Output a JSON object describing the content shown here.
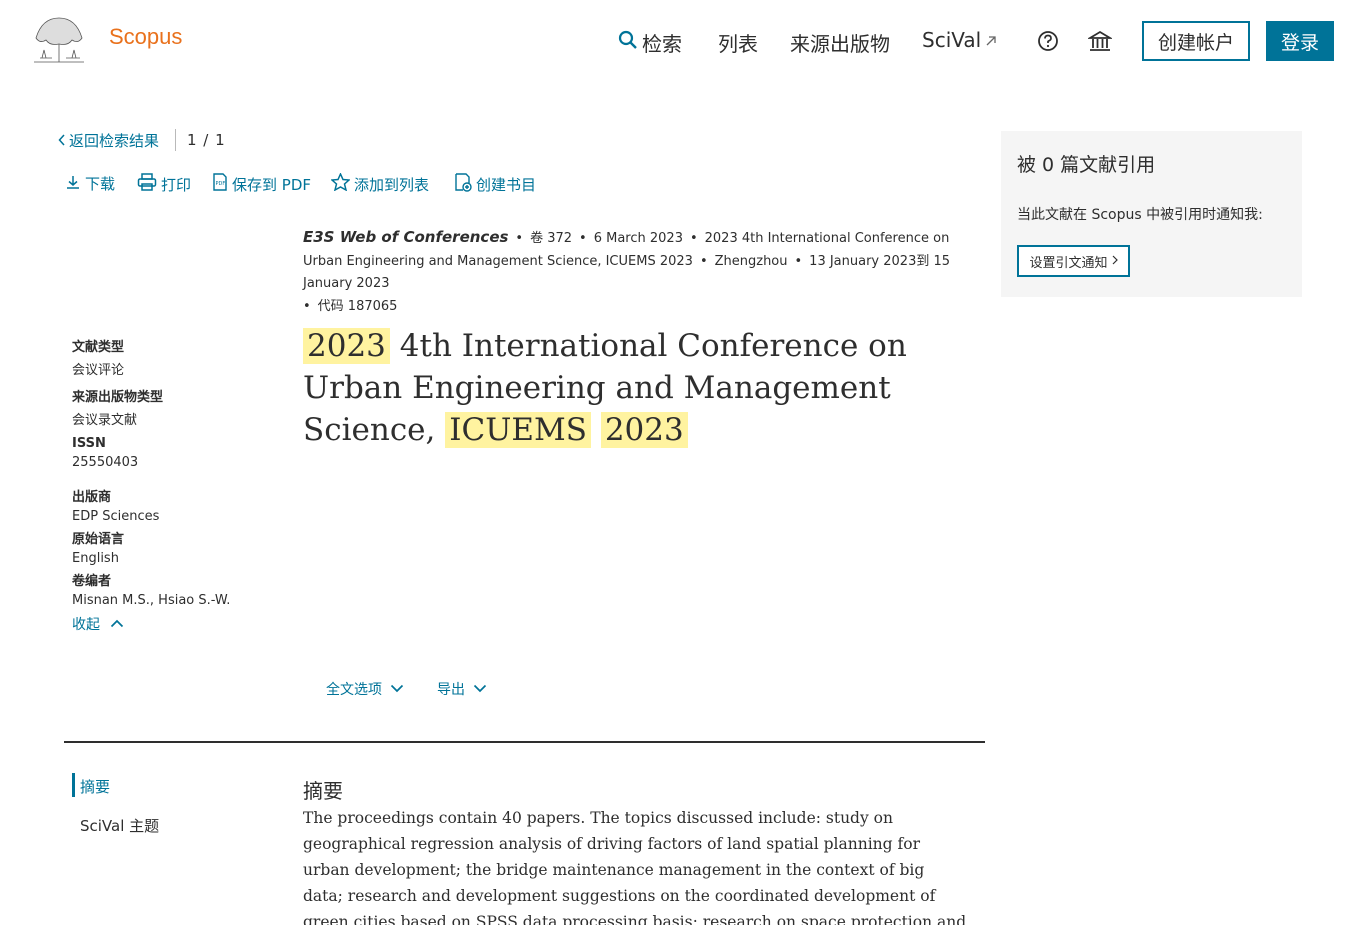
{
  "header": {
    "brand": "Scopus",
    "nav": {
      "search": "检索",
      "lists": "列表",
      "sources": "来源出版物",
      "scival": "SciVal"
    },
    "create_account": "创建帐户",
    "login": "登录"
  },
  "breadcrumb": {
    "back": "返回检索结果",
    "pager": "1 / 1"
  },
  "toolbar": {
    "download": "下载",
    "print": "打印",
    "save_pdf": "保存到 PDF",
    "add_to_list": "添加到列表",
    "create_bib": "创建书目"
  },
  "source": {
    "journal": "E3S Web of Conferences",
    "volume": "卷 372",
    "date": "6 March 2023",
    "conference": "2023 4th International Conference on Urban Engineering and Management Science, ICUEMS 2023",
    "location": "Zhengzhou",
    "conf_dates": "13 January 2023到 15 January 2023",
    "code": "代码 187065"
  },
  "title": {
    "part1": "2023",
    "part2": " 4th International Conference on Urban Engineering and Management Science, ",
    "part3": "ICUEMS",
    "part4": "2023"
  },
  "metadata": {
    "doc_type_label": "文献类型",
    "doc_type": "会议评论",
    "source_type_label": "来源出版物类型",
    "source_type": "会议录文献",
    "issn_label": "ISSN",
    "issn": "25550403",
    "publisher_label": "出版商",
    "publisher": "EDP Sciences",
    "language_label": "原始语言",
    "language": "English",
    "editors_label": "卷编者",
    "editors": "Misnan M.S., Hsiao S.-W.",
    "collapse": "收起"
  },
  "cite_panel": {
    "title": "被 0 篇文献引用",
    "text": "当此文献在 Scopus 中被引用时通知我:",
    "button": "设置引文通知"
  },
  "options": {
    "full_text": "全文选项",
    "export": "导出"
  },
  "subnav": {
    "abstract": "摘要",
    "scival_topic": "SciVal 主题"
  },
  "abstract": {
    "heading": "摘要",
    "body": "The proceedings contain 40 papers. The topics discussed include: study on geographical regression analysis of driving factors of land spatial planning for urban development; the bridge maintenance management in the context of big data; research and development suggestions on the coordinated development of green cities based on SPSS data processing basis; research on space protection and renewal of historic city wall landscape belt in modern"
  }
}
